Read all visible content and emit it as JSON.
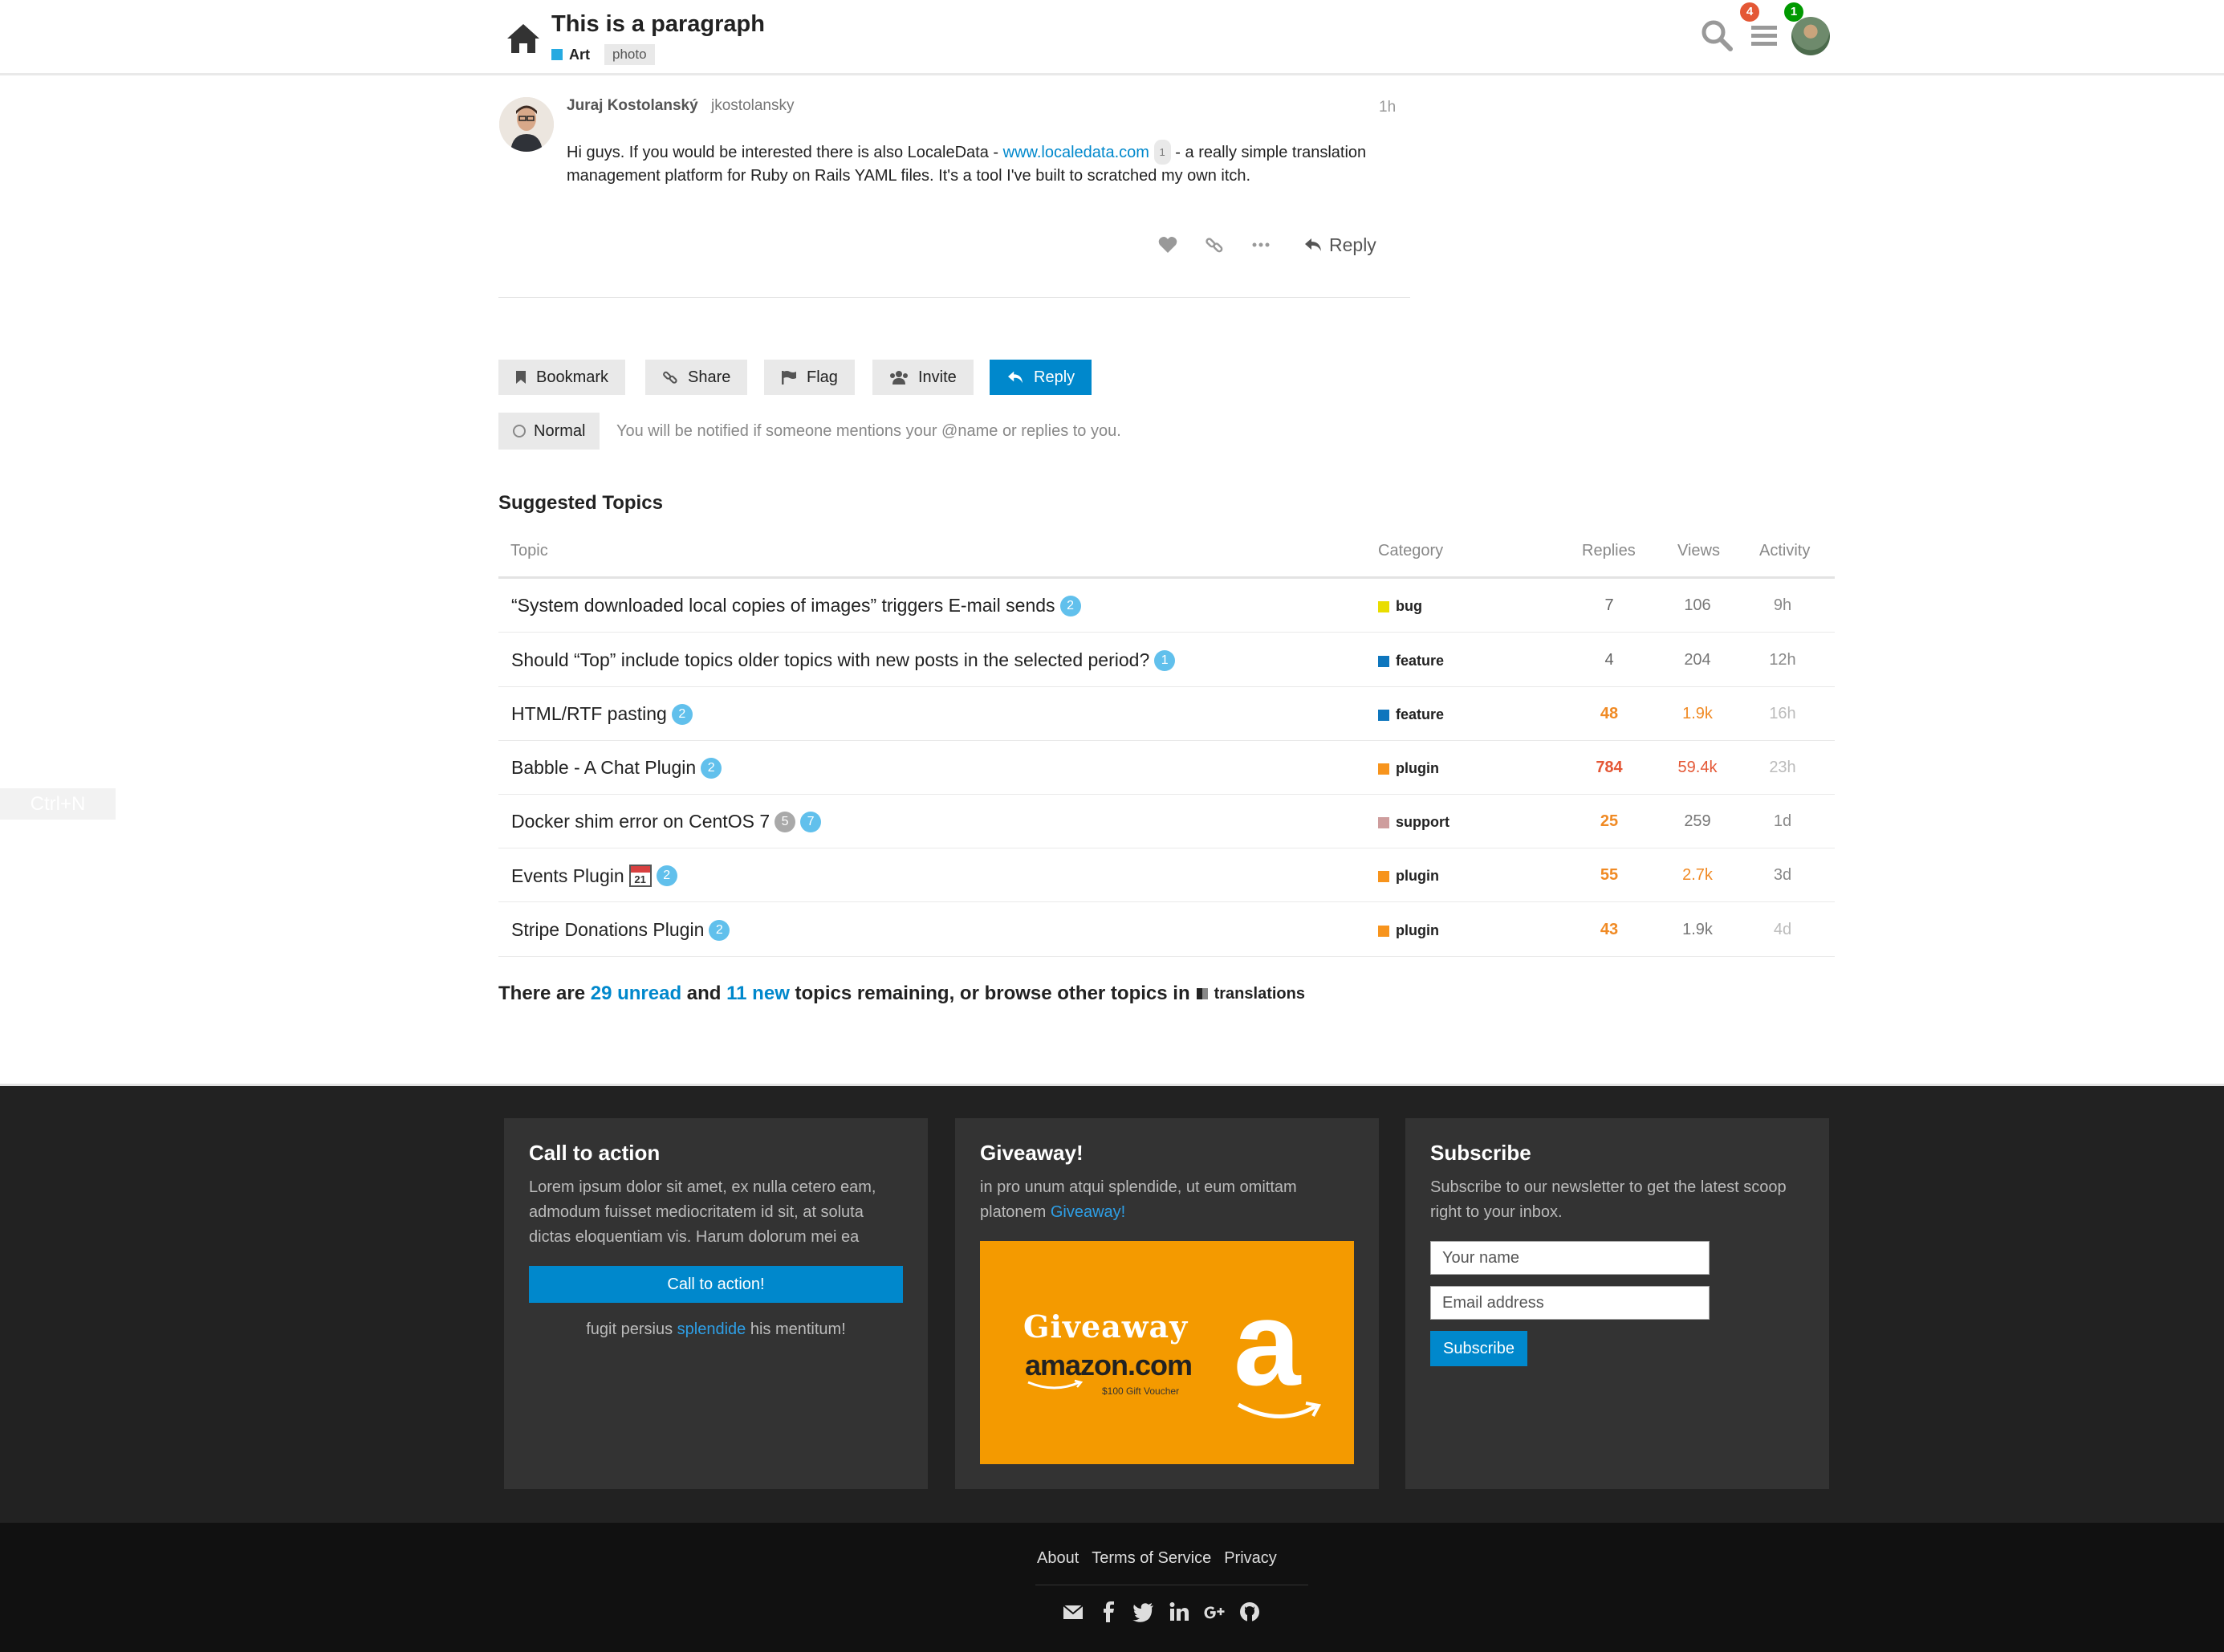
{
  "header": {
    "title": "This is a paragraph",
    "category": {
      "label": "Art",
      "color": "#25aae1"
    },
    "tag": "photo",
    "notifications_count": "4",
    "messages_count": "1"
  },
  "post": {
    "user_name": "Juraj Kostolanský",
    "user_handle": "jkostolansky",
    "time": "1h",
    "body_before_link": "Hi guys. If you would be interested there is also LocaleData - ",
    "link_text": "www.localedata.com",
    "link_clicks": "1",
    "body_after_link": " - a really simple translation management platform for Ruby on Rails YAML files. It's a tool I've built to scratched my own itch.",
    "reply_label": "Reply"
  },
  "topic_buttons": {
    "bookmark": "Bookmark",
    "share": "Share",
    "flag": "Flag",
    "invite": "Invite",
    "reply": "Reply"
  },
  "notification": {
    "level": "Normal",
    "description": "You will be notified if someone mentions your @name or replies to you."
  },
  "suggested": {
    "title": "Suggested Topics",
    "columns": {
      "topic": "Topic",
      "category": "Category",
      "replies": "Replies",
      "views": "Views",
      "activity": "Activity"
    },
    "rows": [
      {
        "title": "“System downloaded local copies of images” triggers E-mail sends",
        "new": "2",
        "category": "bug",
        "cat_color": "#e9dd00",
        "replies": "7",
        "views": "106",
        "activity": "9h"
      },
      {
        "title": "Should “Top” include topics older topics with new posts in the selected period?",
        "new": "1",
        "category": "feature",
        "cat_color": "#0e76bd",
        "replies": "4",
        "views": "204",
        "activity": "12h"
      },
      {
        "title": "HTML/RTF pasting",
        "new": "2",
        "category": "feature",
        "cat_color": "#0e76bd",
        "replies": "48",
        "views": "1.9k",
        "activity": "16h"
      },
      {
        "title": "Babble - A Chat Plugin",
        "new": "2",
        "category": "plugin",
        "cat_color": "#f7941d",
        "replies": "784",
        "views": "59.4k",
        "activity": "23h"
      },
      {
        "title": "Docker shim error on CentOS 7",
        "unread": "5",
        "new": "7",
        "category": "support",
        "cat_color": "#ce9d9d",
        "replies": "25",
        "views": "259",
        "activity": "1d"
      },
      {
        "title": "Events Plugin",
        "calendar_day": "21",
        "new": "2",
        "category": "plugin",
        "cat_color": "#f7941d",
        "replies": "55",
        "views": "2.7k",
        "activity": "3d"
      },
      {
        "title": "Stripe Donations Plugin",
        "new": "2",
        "category": "plugin",
        "cat_color": "#f7941d",
        "replies": "43",
        "views": "1.9k",
        "activity": "4d"
      }
    ],
    "footer": {
      "prefix": "There are ",
      "unread": "29 unread",
      "and": " and ",
      "new": "11 new",
      "suffix": " topics remaining, or browse other topics in ",
      "category": "translations"
    }
  },
  "shortcut_hint": "Ctrl+N",
  "footer_panels": {
    "cta": {
      "title": "Call to action",
      "text": "Lorem ipsum dolor sit amet, ex nulla cetero eam, admodum fuisset mediocritatem id sit, at soluta dictas eloquentiam vis. Harum dolorum mei ea",
      "button": "Call to action!",
      "note_before": "fugit persius ",
      "note_link": "splendide",
      "note_after": " his mentitum!"
    },
    "giveaway": {
      "title": "Giveaway!",
      "text": "in pro unum atqui splendide, ut eum omittam platonem ",
      "link": "Giveaway!",
      "image_title": "Giveaway",
      "image_brand": "amazon.com",
      "image_sub": "$100 Gift Voucher",
      "image_logo": "a"
    },
    "subscribe": {
      "title": "Subscribe",
      "text": "Subscribe to our newsletter to get the latest scoop right to your inbox.",
      "name_placeholder": "Your name",
      "email_placeholder": "Email address",
      "button": "Subscribe"
    }
  },
  "site_footer": {
    "links": [
      "About",
      "Terms of Service",
      "Privacy"
    ],
    "social_icons": [
      "email-icon",
      "facebook-icon",
      "twitter-icon",
      "linkedin-icon",
      "google-plus-icon",
      "github-icon"
    ]
  }
}
